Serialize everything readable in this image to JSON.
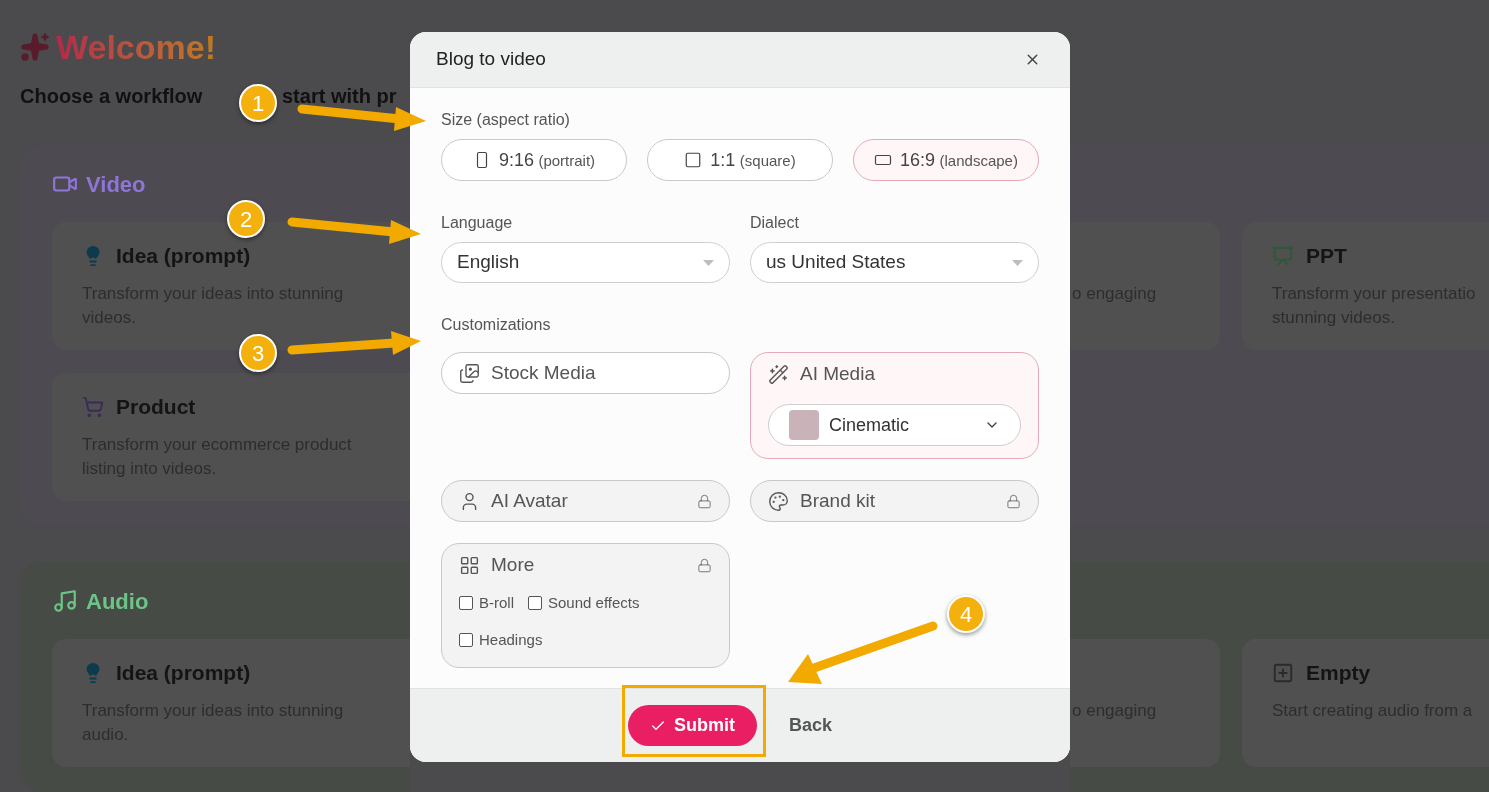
{
  "background": {
    "title": "Welcome!",
    "subtitle": [
      "Choose a workflow",
      "start with pr"
    ],
    "sections": [
      {
        "kind": "video",
        "title": "Video",
        "left_cards": [
          {
            "kind": "idea",
            "title": "Idea (prompt)",
            "description": [
              "Transform your ideas into stunning",
              "videos."
            ]
          },
          {
            "kind": "product",
            "title": "Product",
            "description": [
              "Transform your ecommerce product",
              "listing into videos."
            ]
          }
        ],
        "right_cards": [
          {
            "kind": "partial",
            "description": [
              "o engaging"
            ]
          },
          {
            "kind": "ppt",
            "title": "PPT",
            "description": [
              "Transform your presentatio",
              "stunning videos."
            ]
          }
        ]
      },
      {
        "kind": "audio",
        "title": "Audio",
        "left_cards": [
          {
            "kind": "idea",
            "title": "Idea (prompt)",
            "description": [
              "Transform your ideas into stunning",
              "audio."
            ]
          }
        ],
        "right_cards": [
          {
            "kind": "partial",
            "description": [
              "o engaging"
            ]
          },
          {
            "kind": "empty",
            "title": "Empty",
            "description": [
              "Start creating audio from a"
            ]
          }
        ]
      }
    ]
  },
  "dialog": {
    "title": "Blog to video",
    "size": {
      "label": "Size (aspect ratio)",
      "options": [
        {
          "kind": "portrait",
          "ratio": "9:16",
          "note": "(portrait)",
          "selected": false
        },
        {
          "kind": "square",
          "ratio": "1:1",
          "note": "(square)",
          "selected": false
        },
        {
          "kind": "landscape",
          "ratio": "16:9",
          "note": "(landscape)",
          "selected": true
        }
      ]
    },
    "language": {
      "label": "Language",
      "value": "English"
    },
    "dialect": {
      "label": "Dialect",
      "value": "us United States"
    },
    "customizations": {
      "label": "Customizations",
      "items": [
        {
          "kind": "stock",
          "label": "Stock Media",
          "selected": false,
          "locked": false
        },
        {
          "kind": "ai_media",
          "label": "AI Media",
          "selected": true,
          "locked": false,
          "style": "Cinematic"
        },
        {
          "kind": "avatar",
          "label": "AI Avatar",
          "selected": false,
          "locked": true
        },
        {
          "kind": "brand",
          "label": "Brand kit",
          "selected": false,
          "locked": true
        },
        {
          "kind": "more",
          "label": "More",
          "selected": false,
          "locked": true,
          "options": [
            {
              "label": "B-roll",
              "checked": false
            },
            {
              "label": "Sound effects",
              "checked": false
            },
            {
              "label": "Headings",
              "checked": false
            }
          ]
        }
      ]
    },
    "submit": "Submit",
    "back": "Back"
  },
  "annotations": [
    {
      "label": "1"
    },
    {
      "label": "2"
    },
    {
      "label": "3"
    },
    {
      "label": "4"
    }
  ]
}
